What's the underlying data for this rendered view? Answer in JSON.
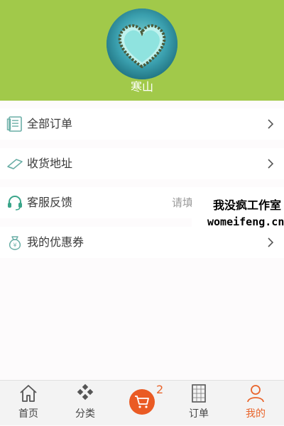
{
  "profile": {
    "username": "寒山"
  },
  "menu": {
    "items": [
      {
        "label": "全部订单",
        "icon": "orders-icon"
      },
      {
        "label": "收货地址",
        "icon": "address-icon"
      },
      {
        "label": "客服反馈",
        "icon": "headset-icon",
        "hint": "请填"
      },
      {
        "label": "我的优惠券",
        "icon": "coupon-bag-icon"
      }
    ]
  },
  "watermark": {
    "line1": "我没疯工作室",
    "line2": "womeifeng.cn"
  },
  "tabbar": {
    "tabs": [
      {
        "label": "首页",
        "icon": "home-icon"
      },
      {
        "label": "分类",
        "icon": "category-icon"
      },
      {
        "label": "",
        "icon": "cart-icon",
        "badge": "2"
      },
      {
        "label": "订单",
        "icon": "order-grid-icon"
      },
      {
        "label": "我的",
        "icon": "user-icon",
        "active": true
      }
    ]
  },
  "colors": {
    "header_bg": "#a1c94a",
    "accent": "#e9642b",
    "icon_teal": "#6aaea6"
  }
}
